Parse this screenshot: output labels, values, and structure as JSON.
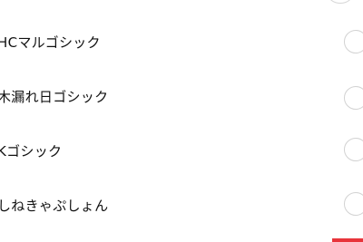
{
  "font_list": {
    "items": [
      {
        "label": "HCマルゴシック",
        "selected": false
      },
      {
        "label": "木漏れ日ゴシック",
        "selected": false
      },
      {
        "label": "Kゴシック",
        "selected": false
      },
      {
        "label": "しねきゃぷしょん",
        "selected": false
      }
    ]
  },
  "colors": {
    "accent": "#e8343b",
    "text": "#111111",
    "radio_border": "#d2d2d2",
    "background": "#ffffff"
  }
}
